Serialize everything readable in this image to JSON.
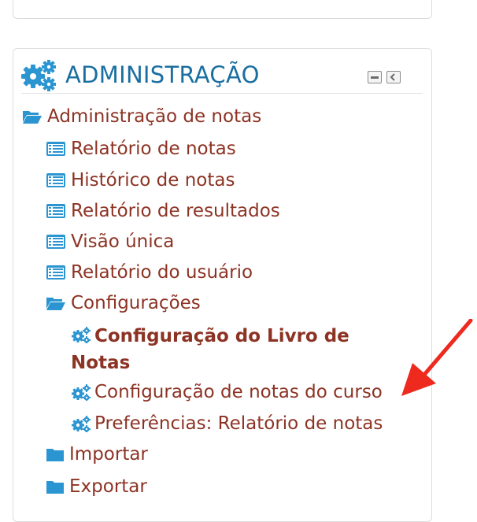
{
  "block": {
    "title": "ADMINISTRAÇÃO",
    "title_icon": "gears-icon",
    "minimize_icon": "minimize-icon",
    "dock_icon": "dock-icon"
  },
  "tree": {
    "grade_admin": {
      "label": "Administração de notas",
      "icon": "folder-open-icon"
    },
    "reports": [
      {
        "label": "Relatório de notas",
        "icon": "report-icon"
      },
      {
        "label": "Histórico de notas",
        "icon": "report-icon"
      },
      {
        "label": "Relatório de resultados",
        "icon": "report-icon"
      },
      {
        "label": "Visão única",
        "icon": "report-icon"
      },
      {
        "label": "Relatório do usuário",
        "icon": "report-icon"
      }
    ],
    "settings": {
      "label": "Configurações",
      "icon": "folder-open-icon"
    },
    "settings_items": [
      {
        "label": "Configuração do Livro de Notas",
        "icon": "gears-icon",
        "active": true
      },
      {
        "label": "Configuração de notas do curso",
        "icon": "gears-icon"
      },
      {
        "label": "Preferências: Relatório de notas",
        "icon": "gears-icon"
      }
    ],
    "import": {
      "label": "Importar",
      "icon": "folder-icon"
    },
    "export": {
      "label": "Exportar",
      "icon": "folder-icon"
    }
  },
  "colors": {
    "link": "#8c3324",
    "title": "#1a6fa0",
    "icon": "#2b95d1",
    "arrow": "#ee2a1f"
  }
}
